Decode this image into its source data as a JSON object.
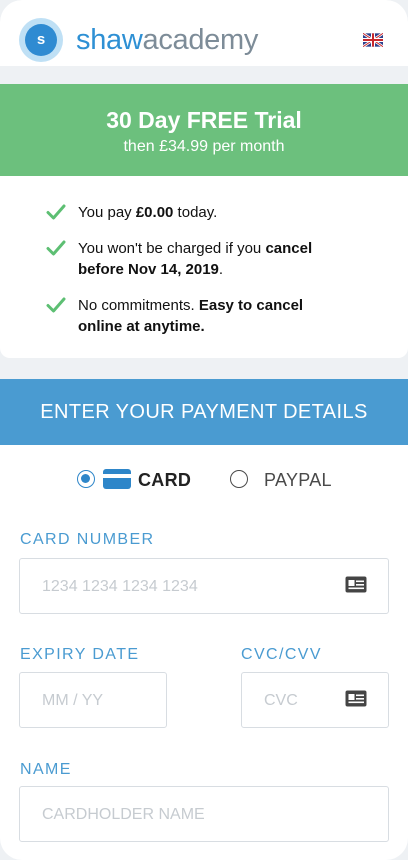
{
  "header": {
    "logo_letter": "s",
    "brand_part1": "shaw",
    "brand_part2": "academy",
    "language_icon": "uk-flag-icon"
  },
  "trial": {
    "title": "30 Day FREE Trial",
    "subtitle": "then £34.99 per month"
  },
  "benefits": [
    {
      "icon": "check-icon",
      "pre": "You pay ",
      "bold": "£0.00",
      "post": " today."
    },
    {
      "icon": "check-icon",
      "pre": "You won't be charged if you ",
      "bold": "cancel before Nov 14, 2019",
      "post": "."
    },
    {
      "icon": "check-icon",
      "pre": "No commitments. ",
      "bold": "Easy to cancel online at anytime.",
      "post": ""
    }
  ],
  "payment": {
    "heading": "ENTER YOUR PAYMENT DETAILS",
    "methods": [
      {
        "label": "CARD",
        "selected": true,
        "icon": "credit-card-icon"
      },
      {
        "label": "PAYPAL",
        "selected": false
      }
    ],
    "card_number": {
      "label": "CARD NUMBER",
      "placeholder": "1234 1234 1234 1234",
      "icon": "id-card-icon"
    },
    "expiry": {
      "label": "EXPIRY DATE",
      "placeholder": "MM / YY"
    },
    "cvc": {
      "label": "CVC/CVV",
      "placeholder": "CVC",
      "icon": "id-card-icon"
    },
    "name": {
      "label": "NAME",
      "placeholder": "CARDHOLDER NAME"
    }
  },
  "colors": {
    "brand_blue": "#2e90d4",
    "brand_grey": "#7d8c98",
    "trial_green": "#6cc07d",
    "check_green": "#5dbf73",
    "payment_blue": "#4a9bd1",
    "radio_blue": "#2e86c9"
  }
}
